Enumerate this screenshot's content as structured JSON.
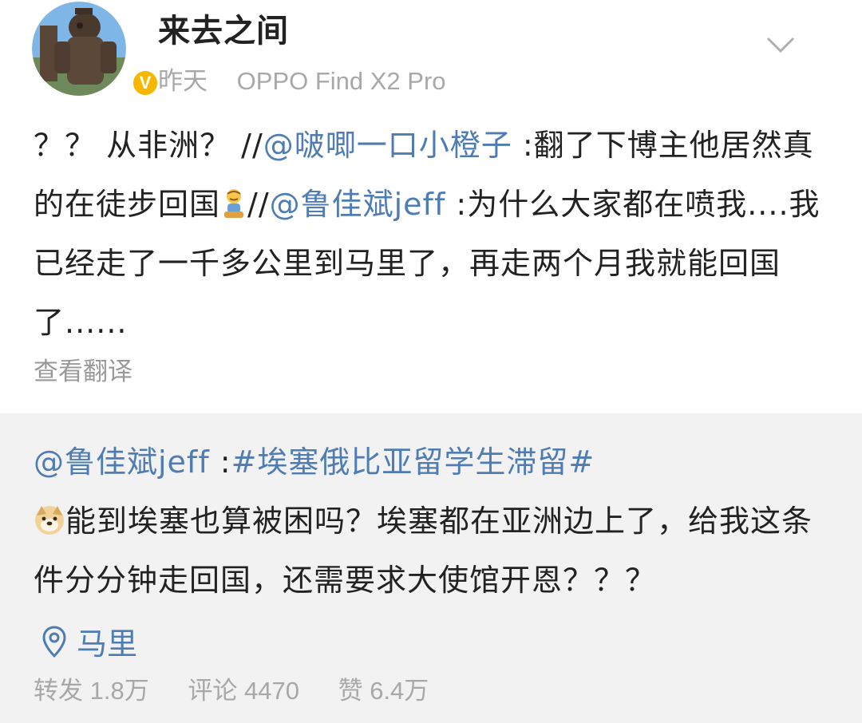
{
  "post": {
    "username": "来去之间",
    "time": "昨天",
    "device": "OPPO Find X2 Pro",
    "badge": "V",
    "text_part1": "？？ 从非洲？ //",
    "mention1": "@啵唧一口小橙子",
    "text_part2": " :翻了下博主他居然真的在徒步回国",
    "text_part3": "//",
    "mention2": "@鲁佳斌jeff",
    "text_part4": " :为什么大家都在喷我....我已经走了一千多公里到马里了，再走两个月我就能回国了......",
    "translate_label": "查看翻译"
  },
  "repost": {
    "mention": "@鲁佳斌jeff",
    "colon": " :",
    "hashtag": "#埃塞俄比亚留学生滞留#",
    "body": "能到埃塞也算被困吗？埃塞都在亚洲边上了，给我这条件分分钟走回国，还需要求大使馆开恩？？？",
    "location": "马里",
    "stats": {
      "repost_label": "转发",
      "repost_count": "1.8万",
      "comment_label": "评论",
      "comment_count": "4470",
      "like_label": "赞",
      "like_count": "6.4万"
    }
  },
  "colors": {
    "link": "#4f7db3",
    "badge": "#f5b700",
    "muted": "#a8a8a8",
    "repost_bg": "#f2f2f2"
  },
  "icons": {
    "chevron": "chevron-down-icon",
    "verified": "verified-badge-icon",
    "location": "location-pin-icon",
    "emoji1": "sitting-person-emoji",
    "emoji2": "doge-emoji"
  }
}
